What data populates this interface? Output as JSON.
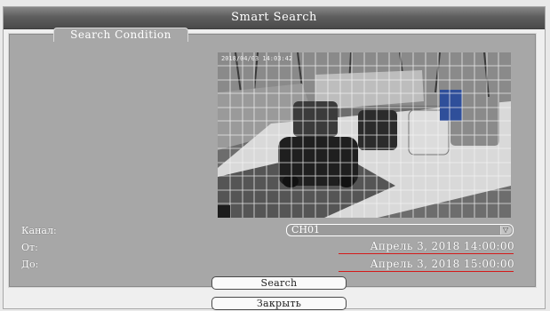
{
  "window": {
    "title": "Smart Search"
  },
  "panel": {
    "legend": "Search Condition"
  },
  "preview": {
    "timestamp": "2018/04/03 14:03:42"
  },
  "form": {
    "channel_label": "Канал:",
    "channel_value": "CH01",
    "from_label": "От:",
    "from_value": "Апрель 3, 2018 14:00:00",
    "to_label": "До:",
    "to_value": "Апрель 3, 2018 15:00:00"
  },
  "buttons": {
    "search": "Search",
    "close": "Закрыть"
  },
  "colors": {
    "title_bar": "#5e5e5e",
    "panel": "#a7a7a7",
    "underline": "#d41a1a"
  },
  "icons": {
    "dropdown": "chevron-down-icon"
  }
}
